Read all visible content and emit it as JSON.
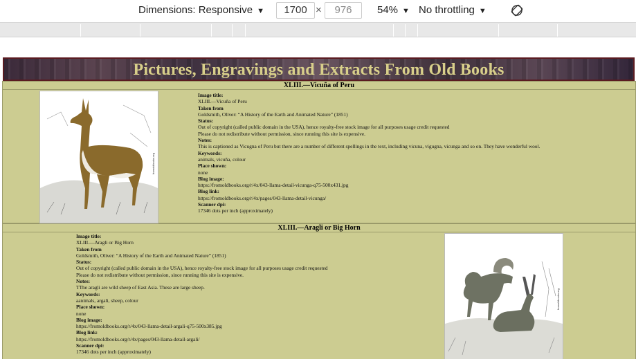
{
  "devtools": {
    "dimensions_label": "Dimensions: Responsive",
    "width_value": "1700",
    "times": "×",
    "height_value": "976",
    "zoom": "54%",
    "throttling": "No throttling",
    "arrow": "▼"
  },
  "site": {
    "banner_title": "Pictures, Engravings and Extracts From Old Books"
  },
  "entries": [
    {
      "heading": "XLIII.—Vicuña of Peru",
      "image_title_label": "Image title:",
      "image_title": "XLIII.—Vicuña of Peru",
      "taken_from_label": "Taken from",
      "taken_from": "Goldsmith, Oliver: “A History of the Earth and Animated Nature” (1851)",
      "status_label": "Status:",
      "status_1": "Out of copyright (called public domain in the USA), hence royalty-free stock image for all purposes usage credit requested",
      "status_2": "Please do not redistribute without permission, since running this site is expensive.",
      "notes_label": "Notes:",
      "notes": "This is captioned as Vicugna of Peru but there are a number of different spellings in the text, including vicuna, vigugna, vicunga and so on. They have wonderful wool.",
      "keywords_label": "Keywords:",
      "keywords": "animals, vicuña, colour",
      "place_label": "Place shown:",
      "place": "none",
      "blog_image_label": "Blog image:",
      "blog_image": "https://fromoldbooks.org/r/4x/043-llama-detail-vicunga-q75-500x431.jpg",
      "blog_link_label": "Blog link:",
      "blog_link": "https://fromoldbooks.org/r/4x/pages/043-llama-detail-vicunga/",
      "dpi_label": "Scanner dpi:",
      "dpi": "17346 dots per inch (approximately)"
    },
    {
      "heading": "XLIII.—Aragli or Big Horn",
      "image_title_label": "Image title:",
      "image_title": "XLIII.—Aragli or Big Horn",
      "taken_from_label": "Taken from",
      "taken_from": "Goldsmith, Oliver: “A History of the Earth and Animated Nature” (1851)",
      "status_label": "Status:",
      "status_1": "Out of copyright (called public domain in the USA), hence royalty-free stock image for all purposes usage credit requested",
      "status_2": "Please do not redistribute without permission, since running this site is expensive.",
      "notes_label": "Notes:",
      "notes": "TThe aragli are wild sheep of East Asia. These are large sheep.",
      "keywords_label": "Keywords:",
      "keywords": "aanimals, argali, sheep, colour",
      "place_label": "Place shown:",
      "place": "none",
      "blog_image_label": "Blog image:",
      "blog_image": "https://fromoldbooks.org/r/4x/043-llama-detail-argali-q75-500x385.jpg",
      "blog_link_label": "Blog link:",
      "blog_link": "https://fromoldbooks.org/r/4x/pages/043-llama-detail-argali/",
      "dpi_label": "Scanner dpi:",
      "dpi": "17346 dots per inch (approximately)"
    }
  ]
}
